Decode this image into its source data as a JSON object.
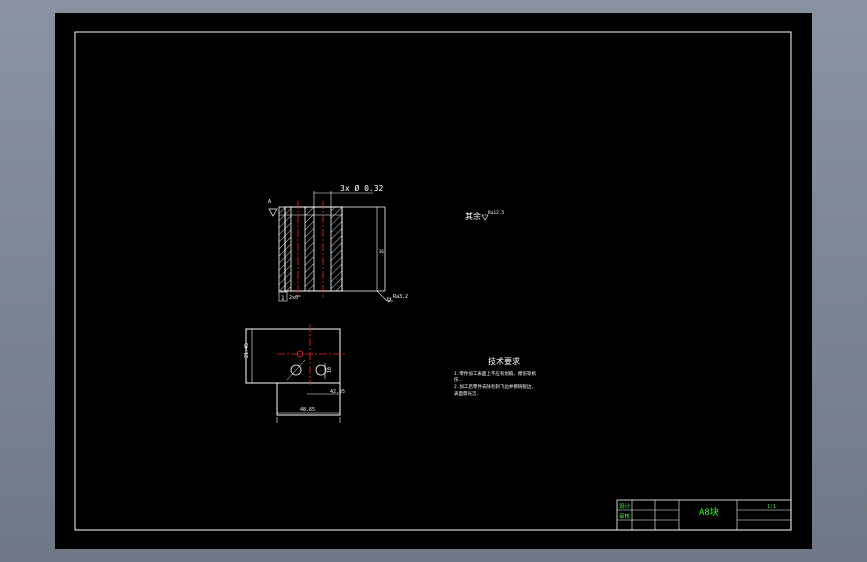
{
  "drawing": {
    "section_view": {
      "hole_callout": "3x Ø 0.32",
      "chamfer_note": "2x0°",
      "height_label": "36",
      "surface_finish": "Ra3.2",
      "section_letter": "A"
    },
    "plan_view": {
      "height_dim": "21.45",
      "width_dim": "48.65",
      "offset_dim": "42.55",
      "hole_dim": "10"
    },
    "roughness_note": {
      "label": "其余",
      "value": "Ra12.5"
    },
    "technical_requirements": {
      "title": "技术要求",
      "lines": [
        "1.零件加工表面上不应有划痕、擦伤等损",
        "伤.",
        "2.加工后零件去除毛刺飞边并倒钝锐边,",
        "表面需光洁."
      ]
    },
    "title_block": {
      "part_name": "A8块",
      "scale": "1:1",
      "row_labels": [
        "设计",
        "审核"
      ]
    }
  }
}
